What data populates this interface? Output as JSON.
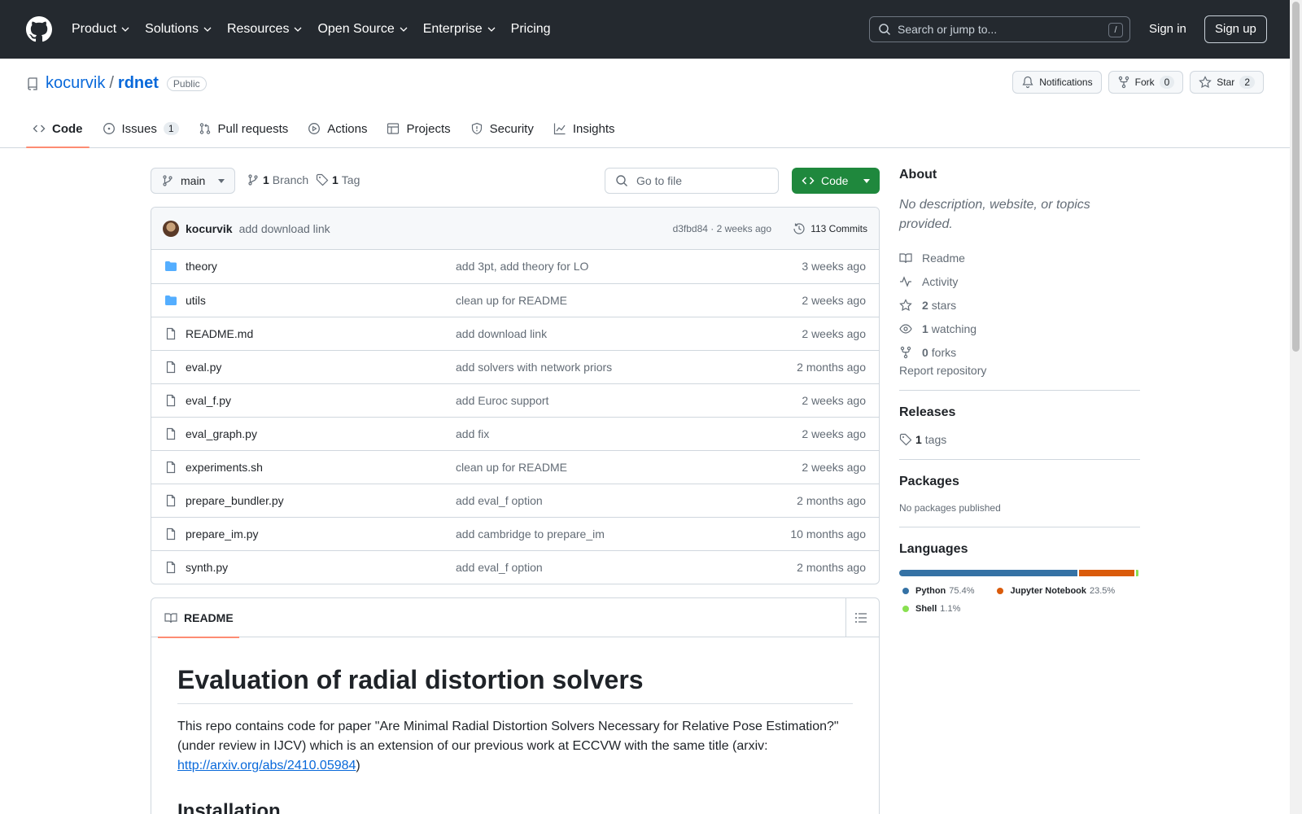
{
  "header": {
    "nav": [
      "Product",
      "Solutions",
      "Resources",
      "Open Source",
      "Enterprise",
      "Pricing"
    ],
    "search_placeholder": "Search or jump to...",
    "search_shortcut": "/",
    "sign_in": "Sign in",
    "sign_up": "Sign up"
  },
  "repo": {
    "owner": "kocurvik",
    "separator": "/",
    "name": "rdnet",
    "visibility": "Public",
    "notifications_label": "Notifications",
    "fork_label": "Fork",
    "fork_count": "0",
    "star_label": "Star",
    "star_count": "2"
  },
  "tabs": [
    {
      "label": "Code",
      "icon": "code-icon",
      "active": true
    },
    {
      "label": "Issues",
      "icon": "issue-icon",
      "count": "1"
    },
    {
      "label": "Pull requests",
      "icon": "pull-request-icon"
    },
    {
      "label": "Actions",
      "icon": "play-icon"
    },
    {
      "label": "Projects",
      "icon": "table-icon"
    },
    {
      "label": "Security",
      "icon": "shield-icon"
    },
    {
      "label": "Insights",
      "icon": "graph-icon"
    }
  ],
  "toolbar": {
    "branch": "main",
    "branch_count": "1",
    "branch_label": "Branch",
    "tag_count": "1",
    "tag_label": "Tag",
    "goto_placeholder": "Go to file",
    "code_button": "Code"
  },
  "last_commit": {
    "author": "kocurvik",
    "message": "add download link",
    "meta": "d3fbd84 · 2 weeks ago",
    "commits": "113 Commits"
  },
  "files": [
    {
      "name": "theory",
      "type": "folder",
      "commit": "add 3pt, add theory for LO",
      "time": "3 weeks ago"
    },
    {
      "name": "utils",
      "type": "folder",
      "commit": "clean up for README",
      "time": "2 weeks ago"
    },
    {
      "name": "README.md",
      "type": "file",
      "commit": "add download link",
      "time": "2 weeks ago"
    },
    {
      "name": "eval.py",
      "type": "file",
      "commit": "add solvers with network priors",
      "time": "2 months ago"
    },
    {
      "name": "eval_f.py",
      "type": "file",
      "commit": "add Euroc support",
      "time": "2 weeks ago"
    },
    {
      "name": "eval_graph.py",
      "type": "file",
      "commit": "add fix",
      "time": "2 weeks ago"
    },
    {
      "name": "experiments.sh",
      "type": "file",
      "commit": "clean up for README",
      "time": "2 weeks ago"
    },
    {
      "name": "prepare_bundler.py",
      "type": "file",
      "commit": "add eval_f option",
      "time": "2 months ago"
    },
    {
      "name": "prepare_im.py",
      "type": "file",
      "commit": "add cambridge to prepare_im",
      "time": "10 months ago"
    },
    {
      "name": "synth.py",
      "type": "file",
      "commit": "add eval_f option",
      "time": "2 months ago"
    }
  ],
  "readme": {
    "tab_label": "README",
    "title": "Evaluation of radial distortion solvers",
    "paragraph": "This repo contains code for paper \"Are Minimal Radial Distortion Solvers Necessary for Relative Pose Estimation?\" (under review in IJCV) which is an extension of our previous work at ECCVW with the same title (arxiv: ",
    "link": "http://arxiv.org/abs/2410.05984",
    "paragraph_end": ")",
    "h2": "Installation"
  },
  "about": {
    "heading": "About",
    "description": "No description, website, or topics provided.",
    "readme": "Readme",
    "activity": "Activity",
    "stars_count": "2",
    "stars_label": "stars",
    "watching_count": "1",
    "watching_label": "watching",
    "forks_count": "0",
    "forks_label": "forks",
    "report": "Report repository"
  },
  "releases": {
    "heading": "Releases",
    "count": "1",
    "label": "tags"
  },
  "packages": {
    "heading": "Packages",
    "text": "No packages published"
  },
  "languages": {
    "heading": "Languages",
    "items": [
      {
        "name": "Python",
        "pct": "75.4%",
        "value": 75.4,
        "color": "#3572A5"
      },
      {
        "name": "Jupyter Notebook",
        "pct": "23.5%",
        "value": 23.5,
        "color": "#DA5B0B"
      },
      {
        "name": "Shell",
        "pct": "1.1%",
        "value": 1.1,
        "color": "#89e051"
      }
    ]
  }
}
